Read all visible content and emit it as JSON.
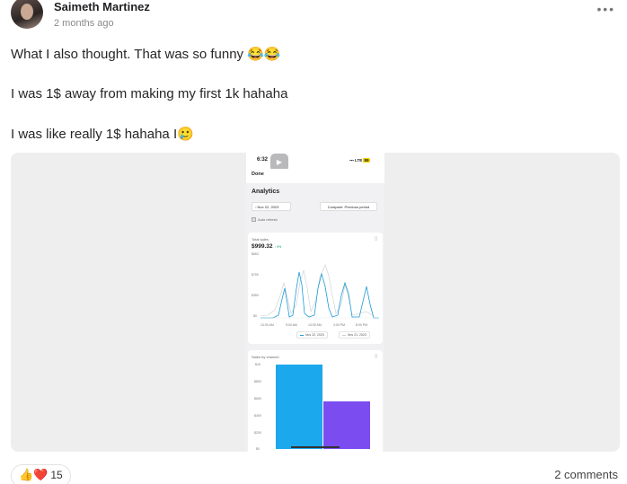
{
  "post": {
    "author": "Saimeth Martinez",
    "timestamp": "2 months ago",
    "paragraphs": [
      "What I also thought. That was so funny 😂😂",
      "I was 1$ away from making my first 1k hahaha",
      "I was like really 1$ hahaha I🥲"
    ]
  },
  "screenshot": {
    "status_time": "6:32",
    "status_signal": "LTE",
    "battery": "89",
    "done_label": "Done",
    "analytics_title": "Analytics",
    "date_filter": "Nov 22, 2023",
    "compare_label": "Compare: Previous period",
    "autorefresh_label": "Auto refresh",
    "total_sales_label": "Total sales",
    "total_sales_value": "$999.32",
    "total_sales_change": "↑ 9%",
    "line_y_ticks": [
      "$653",
      "$700",
      "$350",
      "$0"
    ],
    "line_x_ticks": [
      "10:00 AM",
      "5:00 AM",
      "10:00 AM",
      "3:00 PM",
      "8:00 PM"
    ],
    "legend_current": "Nov 22, 2023",
    "legend_previous": "Nov 21, 2023",
    "colors": {
      "current": "#1e9bd7",
      "previous": "#c9cdd2",
      "bar1": "#1ba8ec",
      "bar2": "#7b4df1"
    },
    "sales_channel_label": "Sales by channel",
    "bar_y_ticks": [
      "$1K",
      "$800",
      "$600",
      "$400",
      "$200",
      "$0"
    ]
  },
  "footer": {
    "reaction_emojis": "👍❤️",
    "reaction_count": "15",
    "comments_label": "2 comments"
  }
}
